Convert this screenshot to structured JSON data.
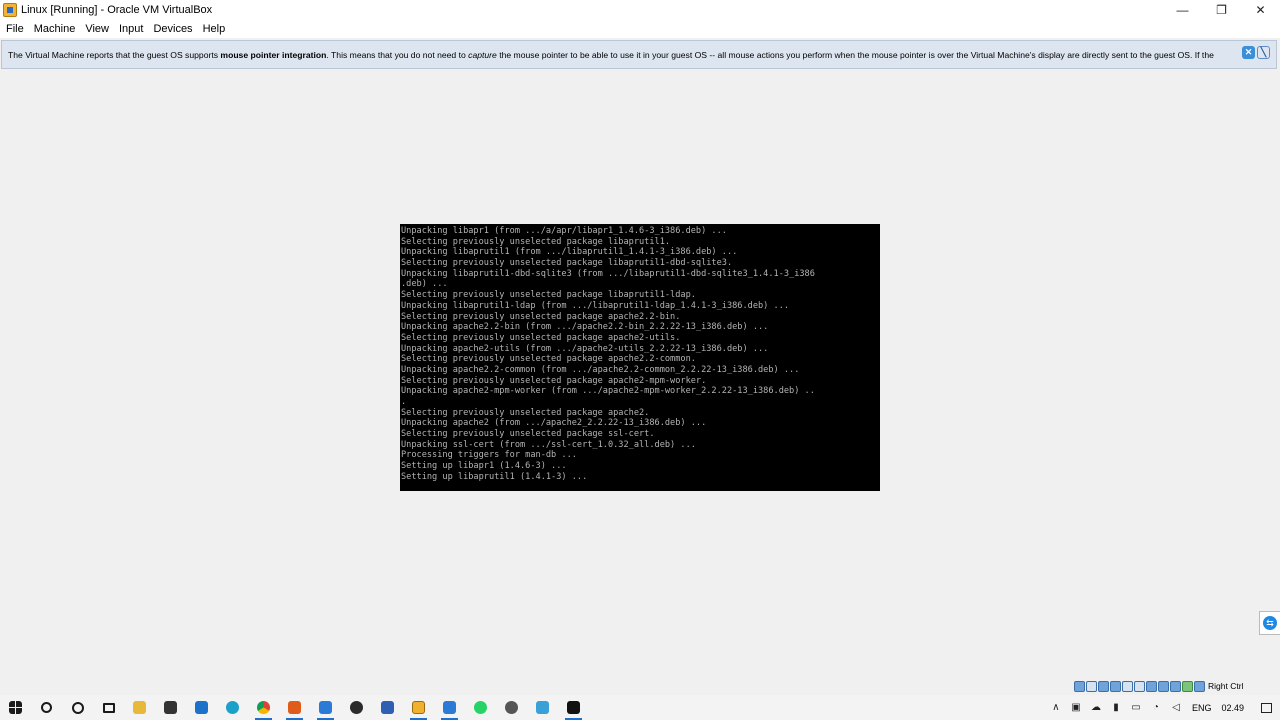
{
  "window": {
    "title": "Linux [Running] - Oracle VM VirtualBox",
    "minimize": "—",
    "restore": "❐",
    "close": "✕"
  },
  "menu": [
    "File",
    "Machine",
    "View",
    "Input",
    "Devices",
    "Help"
  ],
  "notice": {
    "part1": "The Virtual Machine reports that the guest OS supports ",
    "bold": "mouse pointer integration",
    "part2": ". This means that you do not need to ",
    "italic": "capture",
    "part3": " the mouse pointer to be able to use it in your guest OS -- all mouse actions you perform when the mouse pointer is over the Virtual Machine's display are directly sent to the guest OS. If the",
    "close_glyph": "✕",
    "mute_glyph": "╲"
  },
  "terminal": [
    "Unpacking libapr1 (from .../a/apr/libapr1_1.4.6-3_i386.deb) ...",
    "Selecting previously unselected package libaprutil1.",
    "Unpacking libaprutil1 (from .../libaprutil1_1.4.1-3_i386.deb) ...",
    "Selecting previously unselected package libaprutil1-dbd-sqlite3.",
    "Unpacking libaprutil1-dbd-sqlite3 (from .../libaprutil1-dbd-sqlite3_1.4.1-3_i386",
    ".deb) ...",
    "Selecting previously unselected package libaprutil1-ldap.",
    "Unpacking libaprutil1-ldap (from .../libaprutil1-ldap_1.4.1-3_i386.deb) ...",
    "Selecting previously unselected package apache2.2-bin.",
    "Unpacking apache2.2-bin (from .../apache2.2-bin_2.2.22-13_i386.deb) ...",
    "Selecting previously unselected package apache2-utils.",
    "Unpacking apache2-utils (from .../apache2-utils_2.2.22-13_i386.deb) ...",
    "Selecting previously unselected package apache2.2-common.",
    "Unpacking apache2.2-common (from .../apache2.2-common_2.2.22-13_i386.deb) ...",
    "Selecting previously unselected package apache2-mpm-worker.",
    "Unpacking apache2-mpm-worker (from .../apache2-mpm-worker_2.2.22-13_i386.deb) ..",
    ".",
    "Selecting previously unselected package apache2.",
    "Unpacking apache2 (from .../apache2_2.2.22-13_i386.deb) ...",
    "Selecting previously unselected package ssl-cert.",
    "Unpacking ssl-cert (from .../ssl-cert_1.0.32_all.deb) ...",
    "Processing triggers for man-db ...",
    "Setting up libapr1 (1.4.6-3) ...",
    "Setting up libaprutil1 (1.4.1-3) ..."
  ],
  "status_bar": {
    "host_key": "Right Ctrl"
  },
  "taskbar": {
    "language": "ENG",
    "clock": "02.49",
    "tray_chevron": "∧"
  }
}
